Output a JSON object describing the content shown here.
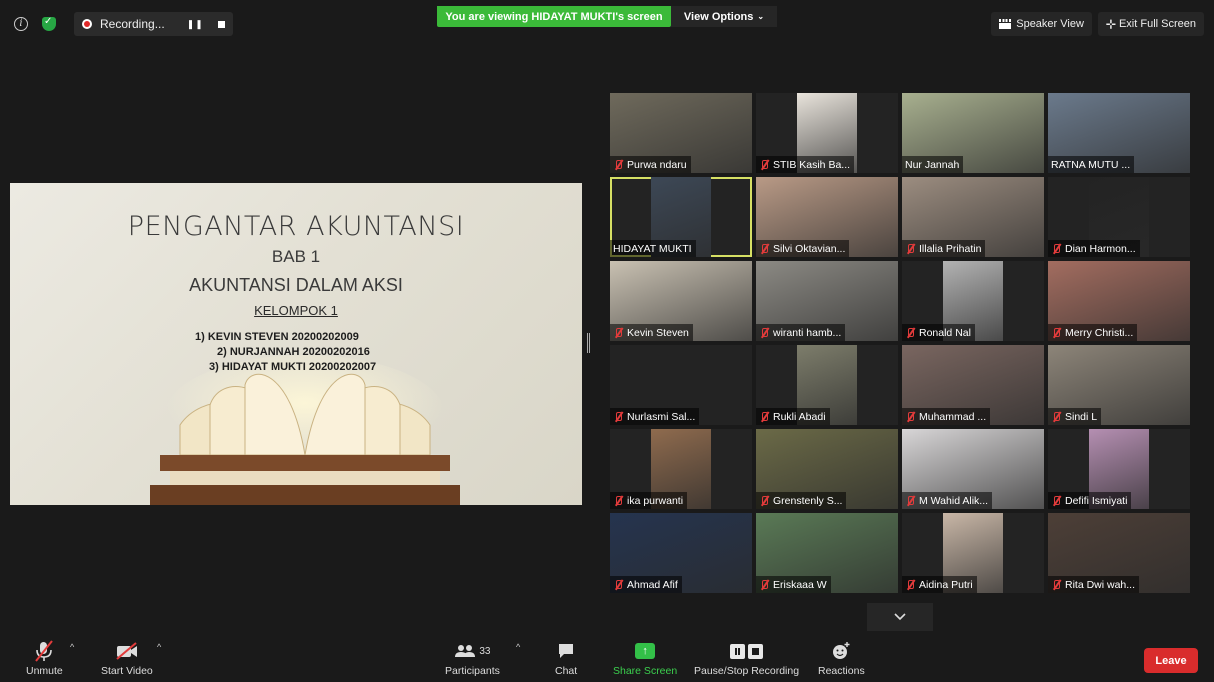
{
  "topbar": {
    "recording_label": "Recording...",
    "banner_text": "You are viewing HIDAYAT MUKTI's screen",
    "view_options_label": "View Options",
    "speaker_view_label": "Speaker View",
    "exit_full_screen_label": "Exit Full Screen"
  },
  "slide": {
    "title": "PENGANTAR AKUNTANSI",
    "chapter": "BAB 1",
    "subtitle": "AKUNTANSI DALAM AKSI",
    "group": "KELOMPOK 1",
    "members": [
      "1) KEVIN STEVEN   20200202009",
      "2) NURJANNAH  20200202016",
      "3) HIDAYAT MUKTI 20200202007"
    ]
  },
  "participants": [
    {
      "name": "Purwa ndaru",
      "muted": true,
      "video": "#6f6a5c"
    },
    {
      "name": "STIB Kasih Ba...",
      "muted": true,
      "video": "#e9e4dc"
    },
    {
      "name": "Nur Jannah",
      "muted": false,
      "video": "#a8b08f"
    },
    {
      "name": "RATNA MUTU ...",
      "muted": false,
      "video": "#6b7a8c"
    },
    {
      "name": "HIDAYAT MUKTI",
      "muted": false,
      "video": "#3d4856",
      "active": true
    },
    {
      "name": "Silvi Oktavian...",
      "muted": true,
      "video": "#b99a86"
    },
    {
      "name": "Illalia Prihatin",
      "muted": true,
      "video": "#9c8d80"
    },
    {
      "name": "Dian Harmon...",
      "muted": true,
      "video": "#232323"
    },
    {
      "name": "Kevin Steven",
      "muted": true,
      "video": "#c9c1b2"
    },
    {
      "name": "wiranti hamb...",
      "muted": true,
      "video": "#8c8a84"
    },
    {
      "name": "Ronald Nal",
      "muted": true,
      "video": "#b3b3b3"
    },
    {
      "name": "Merry Christi...",
      "muted": true,
      "video": "#a36d60"
    },
    {
      "name": "Nurlasmi Sal...",
      "muted": true,
      "video": "#232323"
    },
    {
      "name": "Rukli Abadi",
      "muted": true,
      "video": "#7d7d6b"
    },
    {
      "name": "Muhammad ...",
      "muted": true,
      "video": "#7a6660"
    },
    {
      "name": "Sindi L",
      "muted": true,
      "video": "#8d8579"
    },
    {
      "name": "ika purwanti",
      "muted": true,
      "video": "#8f6b4e"
    },
    {
      "name": "Grenstenly S...",
      "muted": true,
      "video": "#6b6a47"
    },
    {
      "name": "M Wahid Alik...",
      "muted": true,
      "video": "#d8d6d7"
    },
    {
      "name": "Defifi Ismiyati",
      "muted": true,
      "video": "#b58fb2"
    },
    {
      "name": "Ahmad Afif",
      "muted": true,
      "video": "#25344f"
    },
    {
      "name": "Eriskaaa W",
      "muted": true,
      "video": "#5a7a56"
    },
    {
      "name": "Aidina Putri",
      "muted": true,
      "video": "#c9b7a7"
    },
    {
      "name": "Rita Dwi wah...",
      "muted": true,
      "video": "#4d3f37"
    }
  ],
  "toolbar": {
    "unmute_label": "Unmute",
    "start_video_label": "Start Video",
    "participants_label": "Participants",
    "participants_count": "33",
    "chat_label": "Chat",
    "share_screen_label": "Share Screen",
    "pause_stop_label": "Pause/Stop Recording",
    "reactions_label": "Reactions",
    "leave_label": "Leave"
  }
}
